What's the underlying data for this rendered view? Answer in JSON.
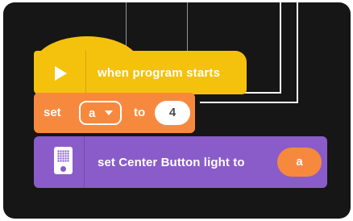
{
  "blocks": {
    "hat": {
      "label": "when program starts",
      "color": "#f4c20d",
      "icon": "play-icon"
    },
    "set_variable": {
      "set_label": "set",
      "variable": "a",
      "to_label": "to",
      "value": "4",
      "color": "#f7893f"
    },
    "center_light": {
      "label": "set Center Button light to",
      "value": "a",
      "color": "#8a5cc9",
      "icon": "hub-icon"
    }
  },
  "canvas": {
    "background": "#161616"
  }
}
